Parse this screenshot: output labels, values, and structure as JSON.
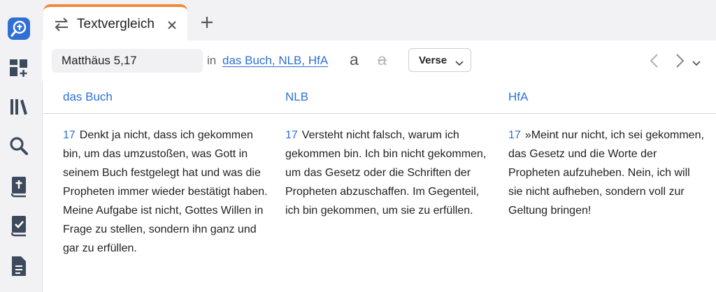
{
  "tab": {
    "title": "Textvergleich",
    "close_icon": "close-icon",
    "add_icon": "plus-icon"
  },
  "toolbar": {
    "reference_value": "Matthäus 5,17",
    "in_label": "in",
    "translations_link": "das Buch, NLB, HfA",
    "font_larger": "a",
    "font_smaller": "a",
    "verse_select": "Verse"
  },
  "columns": [
    {
      "name": "das Buch",
      "verse_number": "17",
      "text": "Denkt ja nicht, dass ich gekommen bin, um das umzustoßen, was Gott in seinem Buch festgelegt hat und was die Propheten immer wieder bestätigt haben. Meine Aufgabe ist nicht, Gottes Willen in Frage zu stellen, sondern ihn ganz und gar zu erfüllen."
    },
    {
      "name": "NLB",
      "verse_number": "17",
      "text": "Versteht nicht falsch, warum ich gekommen bin. Ich bin nicht gekommen, um das Gesetz oder die Schriften der Propheten abzuschaffen. Im Gegenteil, ich bin gekommen, um sie zu erfüllen."
    },
    {
      "name": "HfA",
      "verse_number": "17",
      "text": "»Meint nur nicht, ich sei gekommen, das Gesetz und die Worte der Propheten aufzuheben. Nein, ich will sie nicht aufheben, sondern voll zur Geltung bringen!"
    }
  ],
  "colors": {
    "accent": "#2f6fd6",
    "tab_accent": "#f08a3c",
    "sidebar_bg": "#f2f2f4"
  }
}
